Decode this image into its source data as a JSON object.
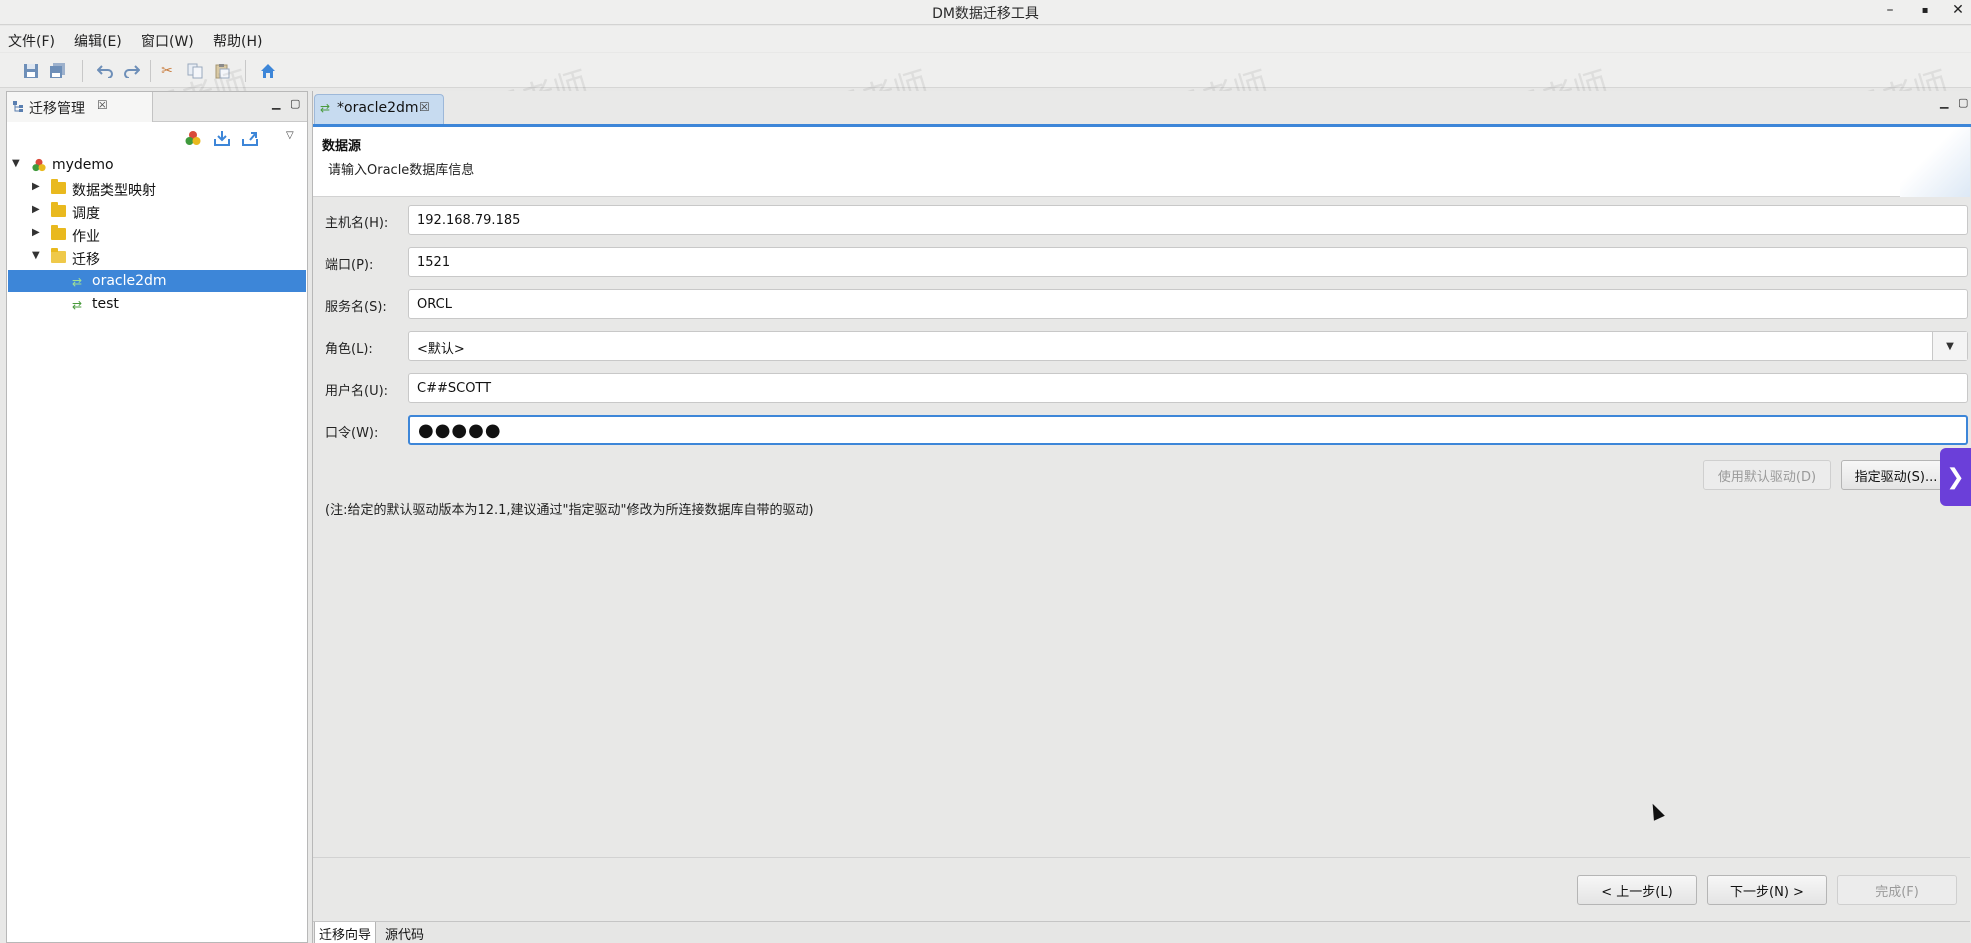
{
  "window": {
    "title": "DM数据迁移工具",
    "controls": [
      "–",
      "▪",
      "✕"
    ]
  },
  "menu": [
    "文件(F)",
    "编辑(E)",
    "窗口(W)",
    "帮助(H)"
  ],
  "toolbar_icons": [
    "save-icon",
    "save-all-icon",
    "undo-icon",
    "redo-icon",
    "cut-icon",
    "copy-icon",
    "paste-icon",
    "home-icon"
  ],
  "left_panel": {
    "tab_label": "迁移管理",
    "tab_close": "☒",
    "tree": {
      "root": "mydemo",
      "items": [
        "数据类型映射",
        "调度",
        "作业",
        "迁移"
      ],
      "migrations": [
        "oracle2dm",
        "test"
      ]
    }
  },
  "editor": {
    "tab_label": "*oracle2dm",
    "tab_close": "☒",
    "header_title": "数据源",
    "header_subtitle": "请输入Oracle数据库信息",
    "fields": {
      "host_label": "主机名(H):",
      "host_value": "192.168.79.185",
      "port_label": "端口(P):",
      "port_value": "1521",
      "service_label": "服务名(S):",
      "service_value": "ORCL",
      "role_label": "角色(L):",
      "role_value": "<默认>",
      "user_label": "用户名(U):",
      "user_value": "C##SCOTT",
      "password_label": "口令(W):",
      "password_value": "●●●●●"
    },
    "driver_buttons": {
      "default_driver": "使用默认驱动(D)",
      "specify_driver": "指定驱动(S)..."
    },
    "note": "(注:给定的默认驱动版本为12.1,建议通过\"指定驱动\"修改为所连接数据库自带的驱动)",
    "nav_buttons": {
      "back": "< 上一步(L)",
      "next": "下一步(N) >",
      "finish": "完成(F)"
    },
    "bottom_tabs": [
      "迁移向导",
      "源代码"
    ]
  },
  "watermark": "赵渝强老师"
}
